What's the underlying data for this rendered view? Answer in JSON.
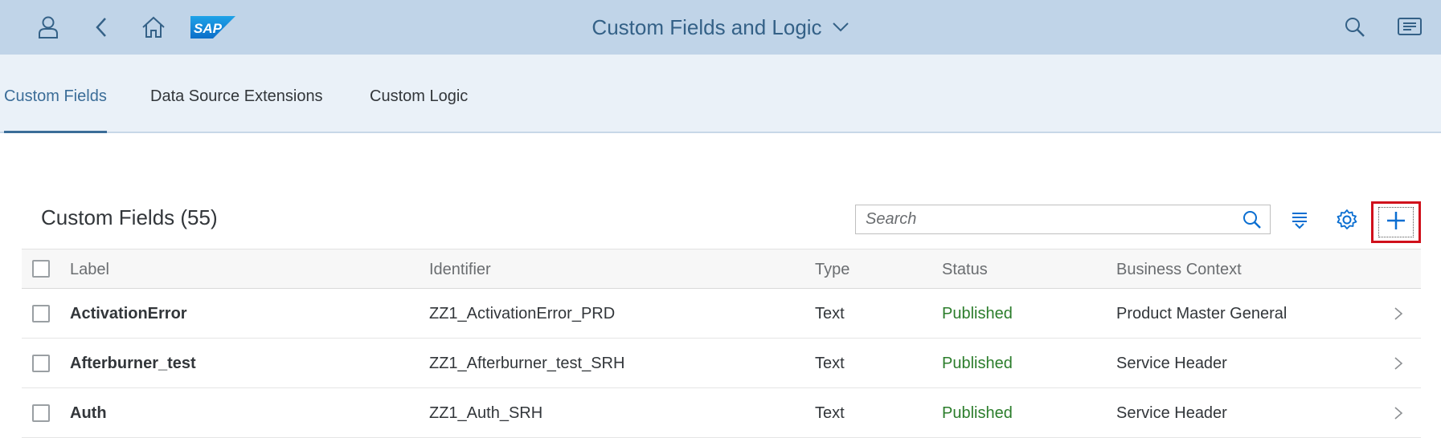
{
  "shell": {
    "title": "Custom Fields and Logic",
    "icons": [
      "user-icon",
      "back-icon",
      "home-icon",
      "search-icon",
      "notifications-icon"
    ],
    "logo_text": "SAP"
  },
  "tabs": [
    {
      "label": "Custom Fields",
      "active": true
    },
    {
      "label": "Data Source Extensions",
      "active": false
    },
    {
      "label": "Custom Logic",
      "active": false
    }
  ],
  "table": {
    "title": "Custom Fields (55)",
    "search_placeholder": "Search",
    "columns": [
      "Label",
      "Identifier",
      "Type",
      "Status",
      "Business Context"
    ],
    "rows": [
      {
        "label": "ActivationError",
        "identifier": "ZZ1_ActivationError_PRD",
        "type": "Text",
        "status": "Published",
        "context": "Product Master General"
      },
      {
        "label": "Afterburner_test",
        "identifier": "ZZ1_Afterburner_test_SRH",
        "type": "Text",
        "status": "Published",
        "context": "Service Header"
      },
      {
        "label": "Auth",
        "identifier": "ZZ1_Auth_SRH",
        "type": "Text",
        "status": "Published",
        "context": "Service Header"
      }
    ]
  },
  "colors": {
    "shell_bg": "#c0d4e8",
    "accent": "#3b6d98",
    "status_published": "#2b7d2b",
    "highlight": "#d0101b"
  }
}
